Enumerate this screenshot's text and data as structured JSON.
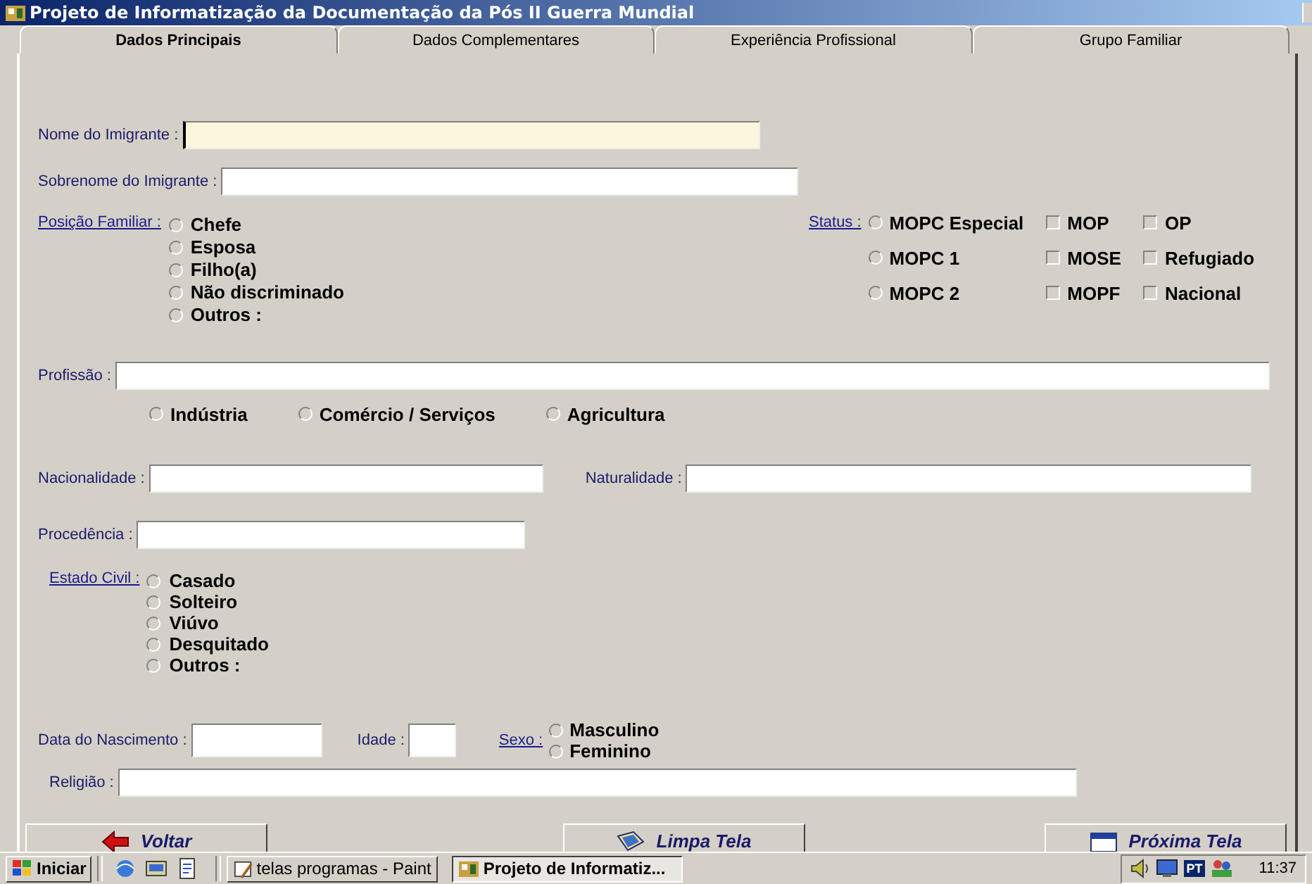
{
  "window": {
    "title": "Projeto de Informatização da Documentação da Pós II Guerra Mundial"
  },
  "tabs": [
    {
      "label": "Dados Principais",
      "selected": true
    },
    {
      "label": "Dados Complementares",
      "selected": false
    },
    {
      "label": "Experiência Profissional",
      "selected": false
    },
    {
      "label": "Grupo Familiar",
      "selected": false
    }
  ],
  "name_field": {
    "label": "Nome do Imigrante :",
    "focused": true
  },
  "surname_field": {
    "label": "Sobrenome do Imigrante :",
    "focused": false
  },
  "family_position": {
    "label": "Posição Familiar :",
    "options": [
      {
        "label": "Chefe",
        "selected": false
      },
      {
        "label": "Esposa",
        "selected": false
      },
      {
        "label": "Filho(a)",
        "selected": false
      },
      {
        "label": "Não discriminado",
        "selected": false
      },
      {
        "label": "Outros :",
        "selected": false
      }
    ]
  },
  "status": {
    "label": "Status :",
    "options": [
      {
        "kind": "radio",
        "label": "MOPC Especial",
        "selected": false
      },
      {
        "kind": "checkbox",
        "label": "MOP",
        "checked": false
      },
      {
        "kind": "checkbox",
        "label": "OP",
        "checked": false
      },
      {
        "kind": "radio",
        "label": "MOPC 1",
        "selected": false
      },
      {
        "kind": "checkbox",
        "label": "MOSE",
        "checked": false
      },
      {
        "kind": "checkbox",
        "label": "Refugiado",
        "checked": false
      },
      {
        "kind": "radio",
        "label": "MOPC 2",
        "selected": false
      },
      {
        "kind": "checkbox",
        "label": "MOPF",
        "checked": false
      },
      {
        "kind": "checkbox",
        "label": "Nacional",
        "checked": false
      }
    ]
  },
  "profession": {
    "label": "Profissão :",
    "sectors": [
      {
        "label": "Indústria",
        "selected": false
      },
      {
        "label": "Comércio / Serviços",
        "selected": false
      },
      {
        "label": "Agricultura",
        "selected": false
      }
    ]
  },
  "nationality": {
    "label": "Nacionalidade :"
  },
  "birthplace": {
    "label": "Naturalidade :"
  },
  "origin": {
    "label": "Procedência :"
  },
  "civil_status": {
    "label": "Estado Civil :",
    "options": [
      {
        "label": "Casado",
        "selected": false
      },
      {
        "label": "Solteiro",
        "selected": false
      },
      {
        "label": "Viúvo",
        "selected": false
      },
      {
        "label": "Desquitado",
        "selected": false
      },
      {
        "label": "Outros :",
        "selected": false
      }
    ]
  },
  "birth_date": {
    "label": "Data do Nascimento :"
  },
  "age": {
    "label": "Idade :"
  },
  "sex": {
    "label": "Sexo :",
    "options": [
      {
        "label": "Masculino",
        "selected": false
      },
      {
        "label": "Feminino",
        "selected": false
      }
    ]
  },
  "religion": {
    "label": "Religião :"
  },
  "buttons": [
    {
      "kind": "back",
      "label": "Voltar"
    },
    {
      "kind": "clear",
      "label": "Limpa Tela"
    },
    {
      "kind": "next",
      "label": "Próxima Tela"
    }
  ],
  "taskbar": {
    "start": "Iniciar",
    "tasks": [
      {
        "kind": "paint",
        "label": "telas programas - Paint",
        "selected": false
      },
      {
        "kind": "app",
        "label": "Projeto de Informatiz...",
        "selected": true
      }
    ],
    "language": "PT",
    "clock": "11:37"
  }
}
